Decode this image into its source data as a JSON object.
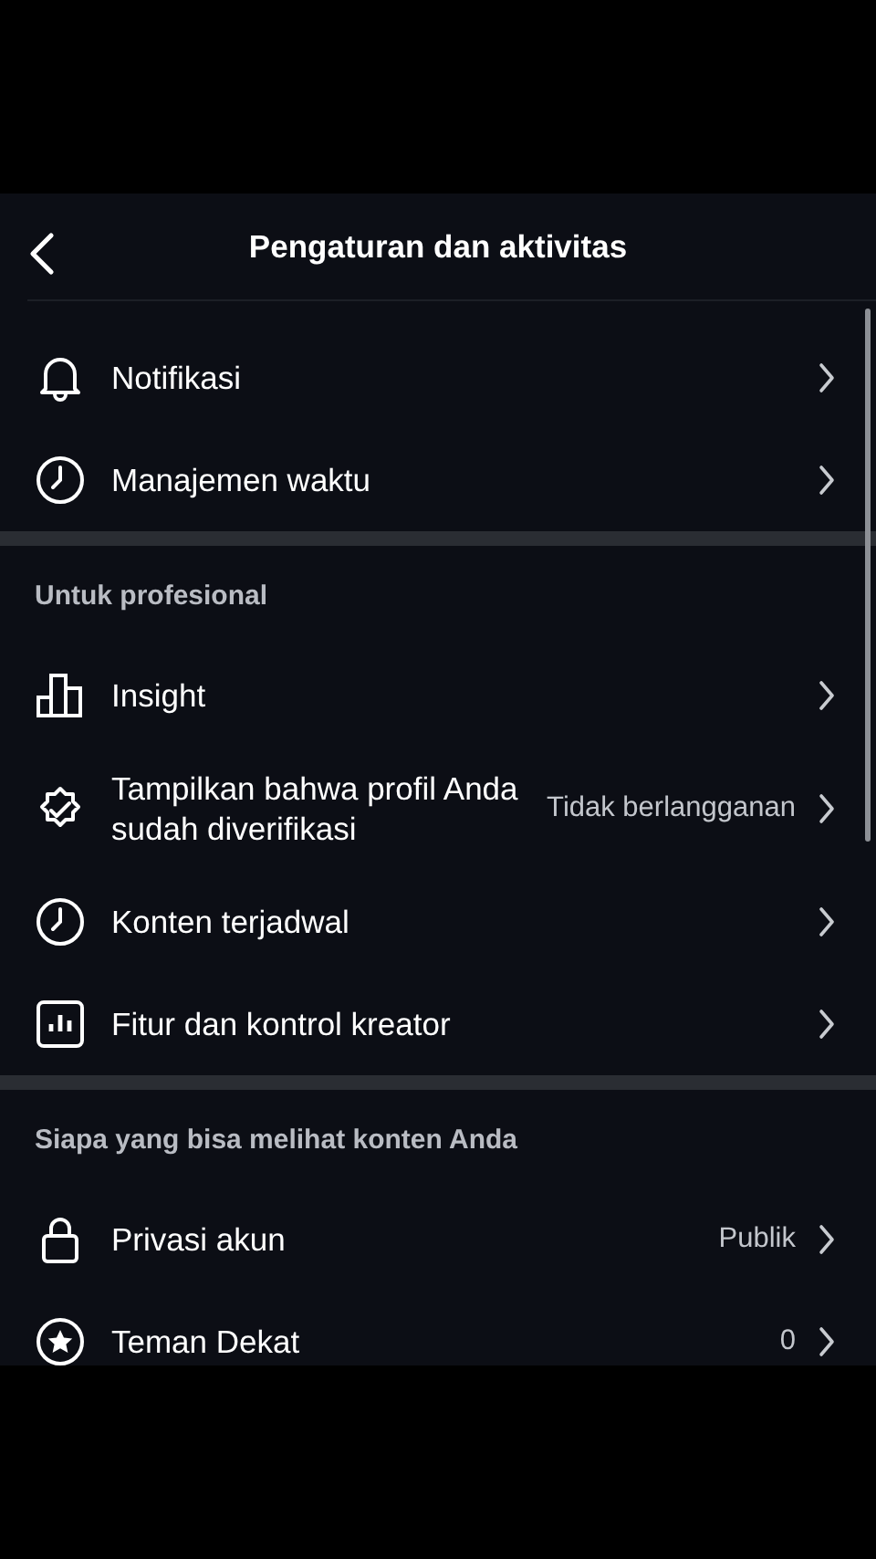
{
  "header": {
    "title": "Pengaturan dan aktivitas"
  },
  "sections": [
    {
      "items": [
        {
          "label": "Notifikasi"
        },
        {
          "label": "Manajemen waktu"
        }
      ]
    },
    {
      "title": "Untuk profesional",
      "items": [
        {
          "label": "Insight"
        },
        {
          "label": "Tampilkan bahwa profil Anda sudah diverifikasi",
          "value": "Tidak berlangganan"
        },
        {
          "label": "Konten terjadwal"
        },
        {
          "label": "Fitur dan kontrol kreator"
        }
      ]
    },
    {
      "title": "Siapa yang bisa melihat konten Anda",
      "items": [
        {
          "label": "Privasi akun",
          "value": "Publik"
        },
        {
          "label": "Teman Dekat",
          "value": "0"
        }
      ]
    }
  ]
}
